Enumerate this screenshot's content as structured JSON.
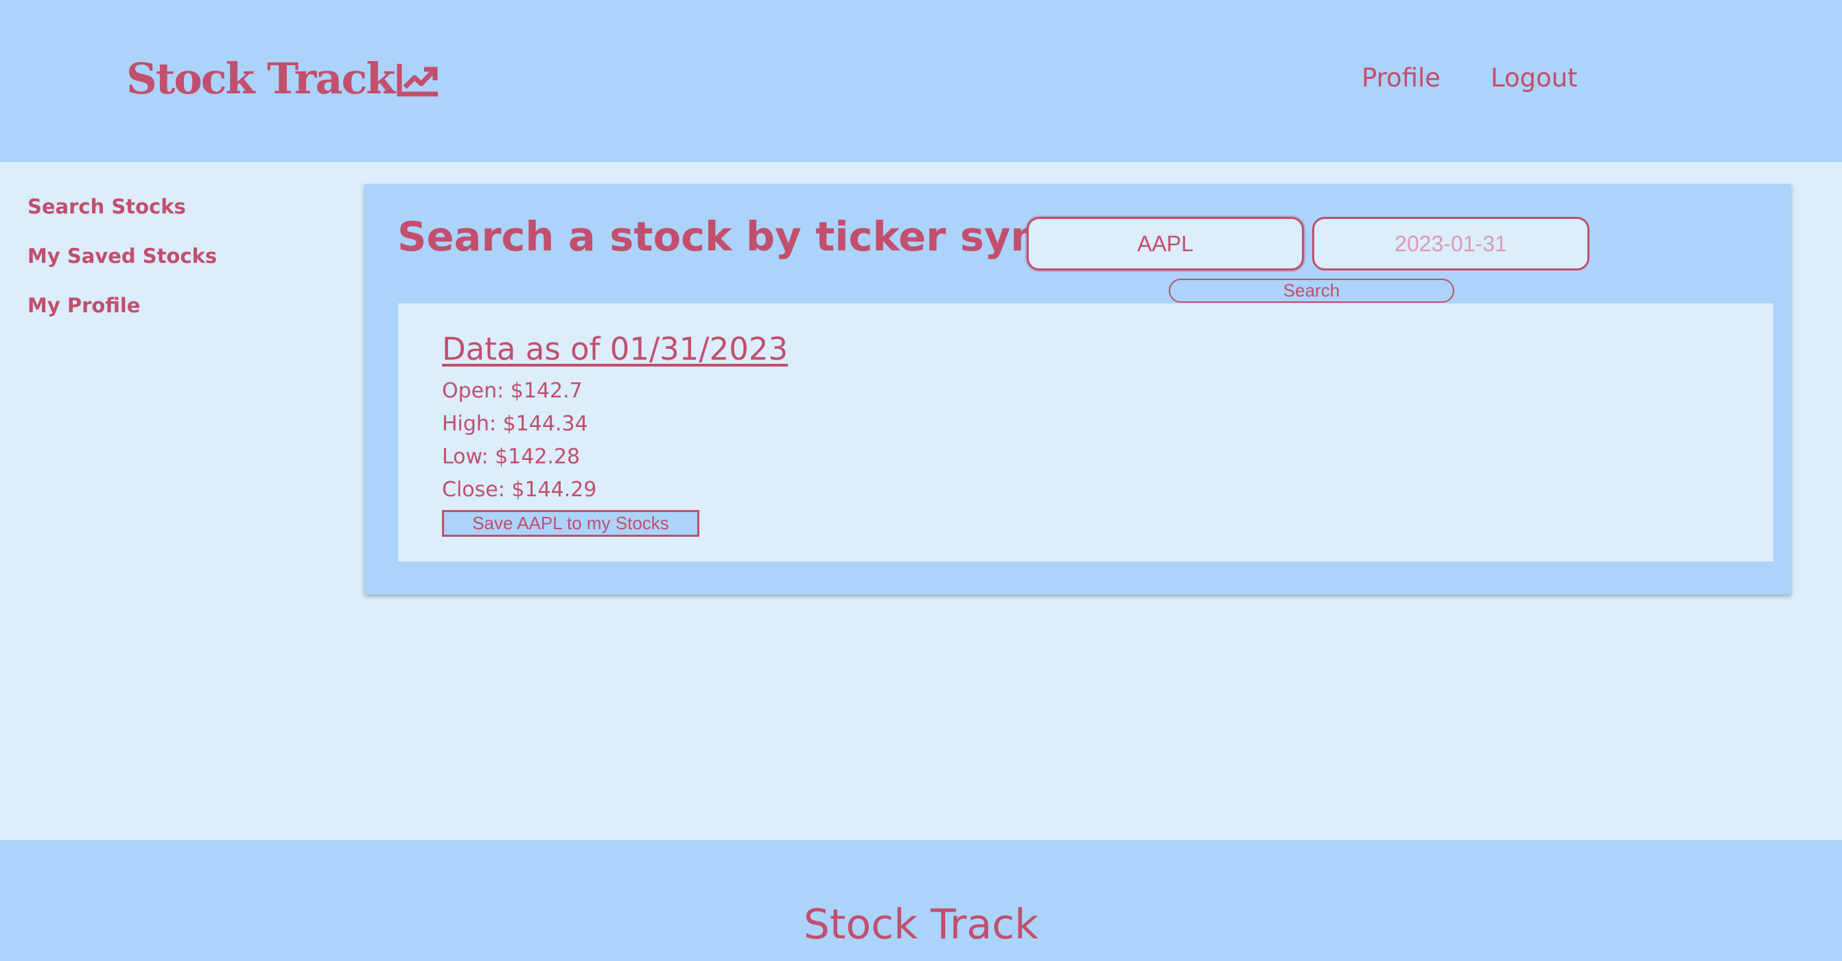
{
  "header": {
    "brand": "Stock Track",
    "brand_icon": "trending-up-chart-icon",
    "nav": {
      "profile": "Profile",
      "logout": "Logout"
    }
  },
  "sidebar": {
    "items": [
      {
        "label": "Search Stocks"
      },
      {
        "label": "My Saved Stocks"
      },
      {
        "label": "My Profile"
      }
    ]
  },
  "search": {
    "title": "Search a stock by ticker symbol:",
    "ticker_value": "AAPL",
    "date_placeholder": "2023-01-31",
    "button_label": "Search"
  },
  "results": {
    "title": "Data as of 01/31/2023",
    "open": "Open: $142.7",
    "high": "High: $144.34",
    "low": "Low: $142.28",
    "close": "Close: $144.29",
    "save_label": "Save AAPL to my Stocks"
  },
  "footer": {
    "text": "Stock Track"
  },
  "colors": {
    "accent": "#c14f6d",
    "header_bg": "#acd3fa",
    "page_bg": "#dcedfc"
  }
}
